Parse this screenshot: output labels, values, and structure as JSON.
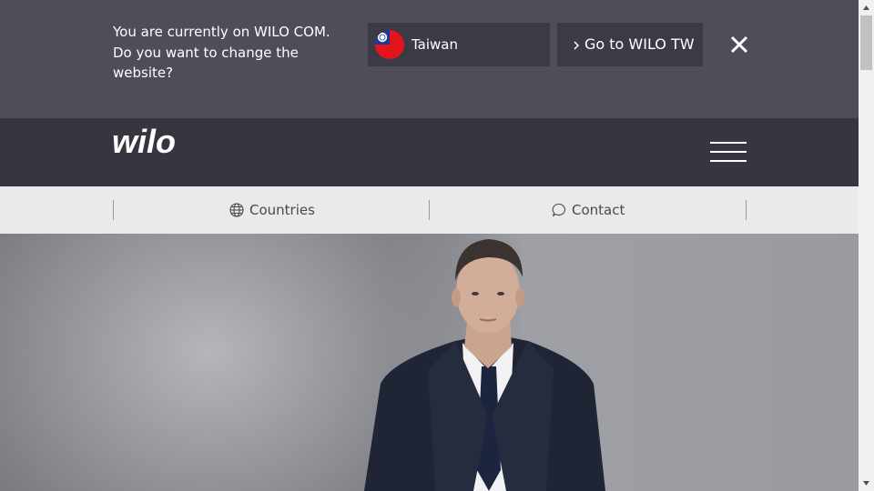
{
  "country_banner": {
    "message": "You are currently on WILO COM. Do you want to change the website?",
    "selected_country": "Taiwan",
    "flag_icon": "taiwan-flag-icon",
    "go_button_label": "Go to WILO TW",
    "close_icon": "close-icon",
    "colors": {
      "background": "#4f4d58",
      "control": "#3c3b45"
    }
  },
  "header": {
    "logo_text": "wilo",
    "menu_icon": "hamburger-menu-icon",
    "colors": {
      "background": "#363640"
    }
  },
  "utility_nav": {
    "items": [
      {
        "label": "Countries",
        "icon": "globe-icon"
      },
      {
        "label": "Contact",
        "icon": "chat-bubble-icon"
      }
    ],
    "colors": {
      "background": "#e9eaea",
      "text": "#4a4a4a"
    }
  },
  "hero": {
    "image_alt": "portrait photo"
  }
}
